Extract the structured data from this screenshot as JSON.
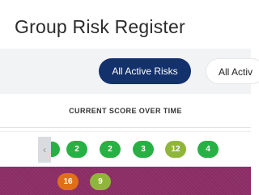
{
  "page": {
    "title": "Group Risk Register"
  },
  "filters": {
    "active_label": "All Active Risks",
    "secondary_label": "All Activ"
  },
  "section": {
    "header": "CURRENT SCORE OVER TIME"
  },
  "scroll": {
    "left_glyph": "‹"
  },
  "rows": [
    {
      "scores": [
        {
          "value": "2",
          "color": "#27b144"
        },
        {
          "value": "2",
          "color": "#27b144"
        },
        {
          "value": "3",
          "color": "#27b144"
        },
        {
          "value": "12",
          "color": "#8fb63b"
        },
        {
          "value": "4",
          "color": "#27b144"
        }
      ]
    },
    {
      "scores": [
        {
          "value": "16",
          "color": "#e07018"
        },
        {
          "value": "9",
          "color": "#8fb63b"
        }
      ]
    }
  ],
  "colors": {
    "accent": "#13316b",
    "row_highlight": "#8a2c64",
    "low": "#27b144",
    "medium": "#8fb63b",
    "high": "#e07018"
  }
}
